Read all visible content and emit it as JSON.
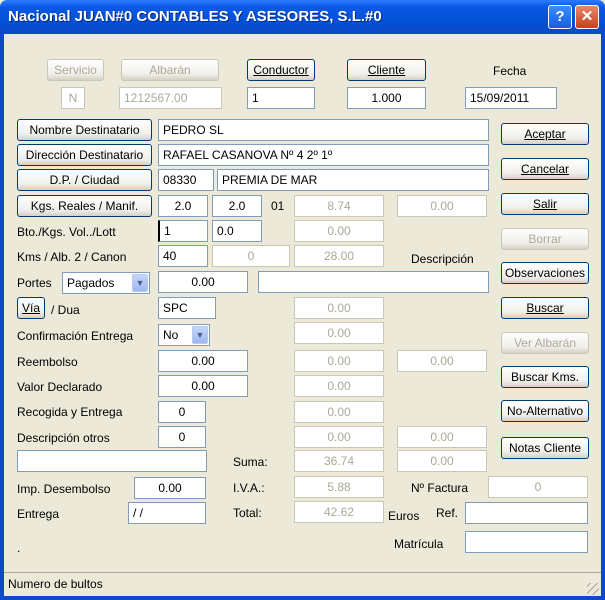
{
  "window": {
    "title": "Nacional  JUAN#0 CONTABLES Y ASESORES, S.L.#0",
    "help_label": "?",
    "close_label": "✕"
  },
  "top": {
    "servicio_label": "Servicio",
    "servicio_value": "N",
    "albaran_label": "Albarán",
    "albaran_value": "1212567.00",
    "conductor_label": "Conductor",
    "conductor_value": "1",
    "cliente_label": "Cliente",
    "cliente_value": "1.000",
    "fecha_label": "Fecha",
    "fecha_value": "15/09/2011"
  },
  "dest": {
    "nombre_label": "Nombre Destinatario",
    "nombre_value": "PEDRO SL",
    "direccion_label": "Dirección Destinatario",
    "direccion_value": "RAFAEL CASANOVA Nº 4 2º 1º",
    "dp_label": "D.P. / Ciudad",
    "dp_value": "08330",
    "ciudad_value": "PREMIA DE MAR"
  },
  "rows": {
    "kgs_label": "Kgs. Reales / Manif.",
    "kgs_real": "2.0",
    "kgs_manif": "2.0",
    "kgs_code": "01",
    "kgs_value": "8.74",
    "kgs_extra": "0.00",
    "bto_label": "Bto./Kgs. Vol../Lott",
    "bto_value": "1",
    "bto_vol": "0.0",
    "bto_total": "0.00",
    "kms_label": "Kms / Alb. 2 / Canon",
    "kms_value": "40",
    "kms_alb": "0",
    "kms_total": "28.00",
    "descripcion_label": "Descripción",
    "portes_label": "Portes",
    "portes_value": "Pagados",
    "portes_amount": "0.00",
    "descripcion_value": "",
    "via_label": "Vía",
    "dua_label": "/ Dua",
    "via_value": "SPC",
    "via_total": "0.00",
    "confirmacion_label": "Confirmación Entrega",
    "confirmacion_value": "No",
    "confirmacion_total": "0.00",
    "reembolso_label": "Reembolso",
    "reembolso_value": "0.00",
    "reembolso_total": "0.00",
    "reembolso_extra": "0.00",
    "valor_label": "Valor Declarado",
    "valor_value": "0.00",
    "valor_total": "0.00",
    "recogida_label": "Recogida y Entrega",
    "recogida_value": "0",
    "recogida_total": "0.00",
    "descotros_label": "Descripción otros",
    "descotros_value": "0",
    "descotros_total": "0.00",
    "descotros_extra": "0.00",
    "otros_text": "",
    "suma_label": "Suma:",
    "suma_value": "36.74",
    "suma_extra": "0.00",
    "impdes_label": "Imp. Desembolso",
    "impdes_value": "0.00",
    "iva_label": "I.V.A.:",
    "iva_value": "5.88",
    "factura_label": "Nº Factura",
    "factura_value": "0",
    "entrega_label": "Entrega",
    "entrega_value": "/ /",
    "total_label": "Total:",
    "total_value": "42.62",
    "euros_label": "Euros",
    "ref_label": "Ref.",
    "ref_value": "",
    "matricula_label": "Matrícula",
    "matricula_value": "",
    "dot": "."
  },
  "actions": {
    "aceptar": "Aceptar",
    "cancelar": "Cancelar",
    "salir": "Salir",
    "borrar": "Borrar",
    "observaciones": "Observaciones",
    "buscar": "Buscar",
    "ver_albaran": "Ver Albarán",
    "buscar_kms": "Buscar Kms.",
    "no_alternativo": "No-Alternativo",
    "notas_cliente": "Notas Cliente"
  },
  "status": {
    "text": "Numero de bultos"
  }
}
